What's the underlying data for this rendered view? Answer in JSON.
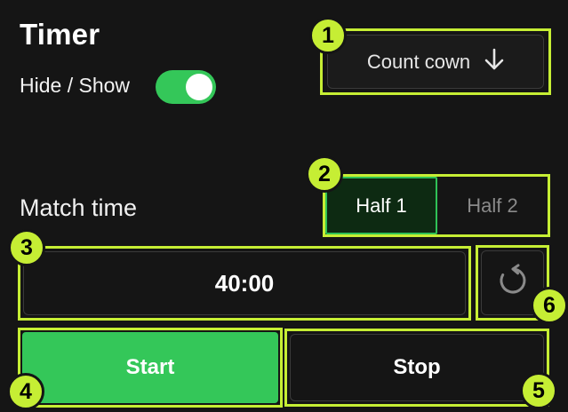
{
  "header": {
    "title": "Timer",
    "hide_show_label": "Hide / Show",
    "hide_show_enabled": true
  },
  "mode_button": {
    "label": "Count cown",
    "icon": "arrow-down-icon"
  },
  "match": {
    "label": "Match time",
    "halves": [
      {
        "label": "Half 1",
        "selected": true
      },
      {
        "label": "Half 2",
        "selected": false
      }
    ],
    "time_display": "40:00",
    "reset_icon": "refresh-icon"
  },
  "controls": {
    "start_label": "Start",
    "stop_label": "Stop"
  },
  "annotations": [
    "1",
    "2",
    "3",
    "4",
    "5",
    "6"
  ],
  "colors": {
    "accent_green": "#34c759",
    "highlight": "#c6ee34",
    "background": "#151515"
  }
}
